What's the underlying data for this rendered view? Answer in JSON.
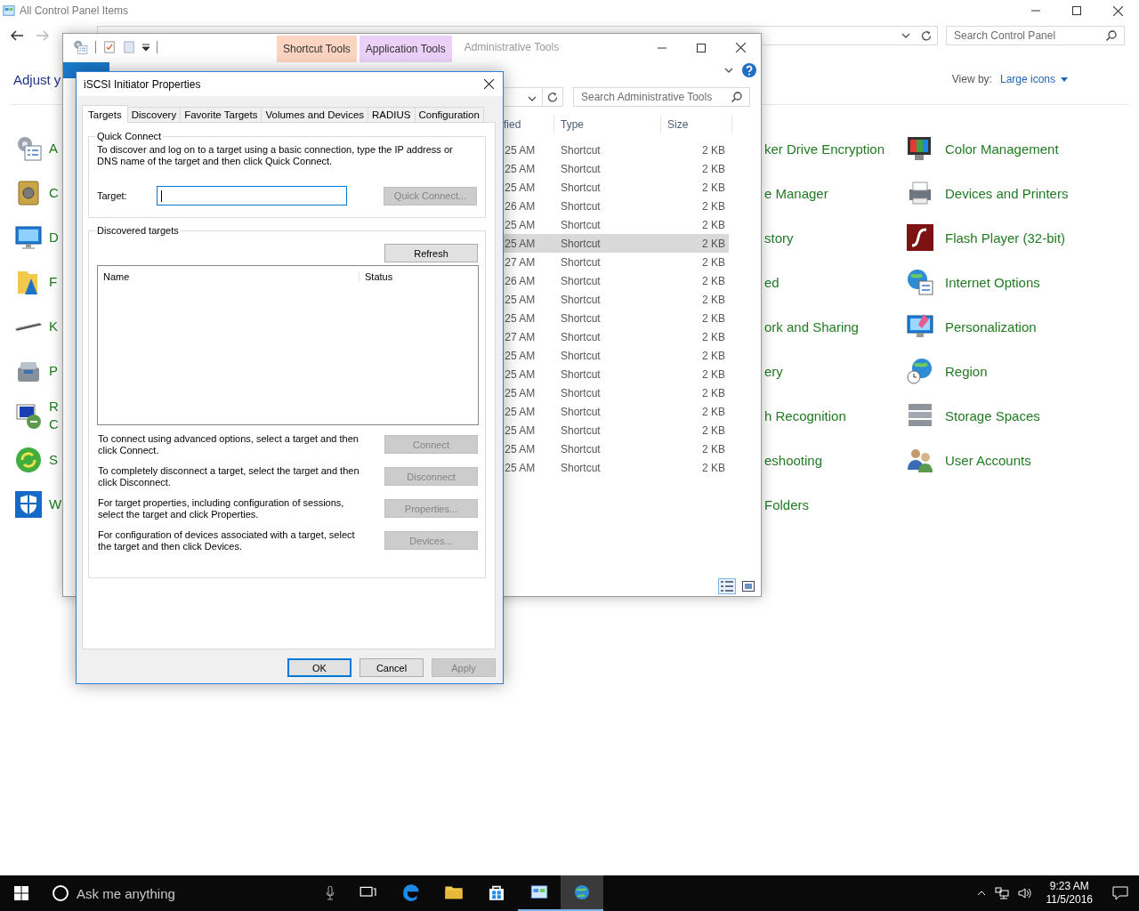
{
  "control_panel": {
    "title": "All Control Panel Items",
    "search": {
      "placeholder": "Search Control Panel"
    },
    "heading": "Adjust y",
    "view_by": {
      "label": "View by:",
      "value": "Large icons"
    },
    "left_items": [
      {
        "lines": [
          "A"
        ]
      },
      {
        "lines": [
          "C"
        ]
      },
      {
        "lines": [
          "D"
        ]
      },
      {
        "lines": [
          "F"
        ]
      },
      {
        "lines": [
          "K"
        ]
      },
      {
        "lines": [
          "P"
        ]
      },
      {
        "lines": [
          "R",
          "C"
        ]
      },
      {
        "lines": [
          "S"
        ]
      },
      {
        "lines": [
          "W"
        ]
      }
    ],
    "middle_items": [
      "ker Drive Encryption",
      "e Manager",
      "story",
      "ed",
      "ork and Sharing",
      "ery",
      "h Recognition",
      "eshooting",
      "Folders"
    ],
    "right_items": [
      "Color Management",
      "Devices and Printers",
      "Flash Player (32-bit)",
      "Internet Options",
      "Personalization",
      "Region",
      "Storage Spaces",
      "User Accounts"
    ]
  },
  "admin_window": {
    "title": "Administrative Tools",
    "context_tabs": [
      {
        "label": "Shortcut Tools",
        "color": "#fcd5c2"
      },
      {
        "label": "Application Tools",
        "color": "#ebd0f7"
      }
    ],
    "search": {
      "placeholder": "Search Administrative Tools"
    },
    "columns": [
      "fied",
      "Type",
      "Size"
    ],
    "rows": [
      {
        "modified": ":25 AM",
        "type": "Shortcut",
        "size": "2 KB",
        "selected": false
      },
      {
        "modified": ":25 AM",
        "type": "Shortcut",
        "size": "2 KB",
        "selected": false
      },
      {
        "modified": ":25 AM",
        "type": "Shortcut",
        "size": "2 KB",
        "selected": false
      },
      {
        "modified": ":26 AM",
        "type": "Shortcut",
        "size": "2 KB",
        "selected": false
      },
      {
        "modified": ":25 AM",
        "type": "Shortcut",
        "size": "2 KB",
        "selected": false
      },
      {
        "modified": ":25 AM",
        "type": "Shortcut",
        "size": "2 KB",
        "selected": true
      },
      {
        "modified": ":27 AM",
        "type": "Shortcut",
        "size": "2 KB",
        "selected": false
      },
      {
        "modified": ":26 AM",
        "type": "Shortcut",
        "size": "2 KB",
        "selected": false
      },
      {
        "modified": ":25 AM",
        "type": "Shortcut",
        "size": "2 KB",
        "selected": false
      },
      {
        "modified": ":25 AM",
        "type": "Shortcut",
        "size": "2 KB",
        "selected": false
      },
      {
        "modified": ":27 AM",
        "type": "Shortcut",
        "size": "2 KB",
        "selected": false
      },
      {
        "modified": ":25 AM",
        "type": "Shortcut",
        "size": "2 KB",
        "selected": false
      },
      {
        "modified": ":25 AM",
        "type": "Shortcut",
        "size": "2 KB",
        "selected": false
      },
      {
        "modified": ":25 AM",
        "type": "Shortcut",
        "size": "2 KB",
        "selected": false
      },
      {
        "modified": ":25 AM",
        "type": "Shortcut",
        "size": "2 KB",
        "selected": false
      },
      {
        "modified": ":25 AM",
        "type": "Shortcut",
        "size": "2 KB",
        "selected": false
      },
      {
        "modified": ":25 AM",
        "type": "Shortcut",
        "size": "2 KB",
        "selected": false
      },
      {
        "modified": ":25 AM",
        "type": "Shortcut",
        "size": "2 KB",
        "selected": false
      }
    ]
  },
  "dialog": {
    "title": "iSCSI Initiator Properties",
    "tabs": [
      {
        "label": "Targets",
        "selected": true
      },
      {
        "label": "Discovery",
        "selected": false
      },
      {
        "label": "Favorite Targets",
        "selected": false
      },
      {
        "label": "Volumes and Devices",
        "selected": false
      },
      {
        "label": "RADIUS",
        "selected": false
      },
      {
        "label": "Configuration",
        "selected": false
      }
    ],
    "quick_connect": {
      "legend": "Quick Connect",
      "description": "To discover and log on to a target using a basic connection, type the IP address or DNS name of the target and then click Quick Connect.",
      "target_label": "Target:",
      "target_focused": true,
      "button": {
        "label": "Quick Connect...",
        "disabled": true
      }
    },
    "discovered": {
      "legend": "Discovered targets",
      "refresh": {
        "label": "Refresh",
        "disabled": false
      },
      "columns": [
        "Name",
        "Status"
      ],
      "actions": [
        {
          "text": "To connect using advanced options, select a target and then click Connect.",
          "button": {
            "label": "Connect",
            "disabled": true
          }
        },
        {
          "text": "To completely disconnect a target, select the target and then click Disconnect.",
          "button": {
            "label": "Disconnect",
            "disabled": true
          }
        },
        {
          "text": "For target properties, including configuration of sessions, select the target and click Properties.",
          "button": {
            "label": "Properties...",
            "disabled": true
          }
        },
        {
          "text": "For configuration of devices associated with a target, select the target and then click Devices.",
          "button": {
            "label": "Devices...",
            "disabled": true
          }
        }
      ]
    },
    "buttons": [
      {
        "label": "OK",
        "disabled": false,
        "default": true
      },
      {
        "label": "Cancel",
        "disabled": false,
        "default": false
      },
      {
        "label": "Apply",
        "disabled": true,
        "default": false
      }
    ]
  },
  "taskbar": {
    "search": {
      "placeholder": "Ask me anything"
    },
    "apps": [
      {
        "running": false,
        "selected": false
      },
      {
        "running": false,
        "selected": false
      },
      {
        "running": false,
        "selected": false
      },
      {
        "running": false,
        "selected": false
      },
      {
        "running": true,
        "selected": false
      },
      {
        "running": true,
        "selected": true
      }
    ],
    "time": "9:23 AM",
    "date": "11/5/2016"
  }
}
